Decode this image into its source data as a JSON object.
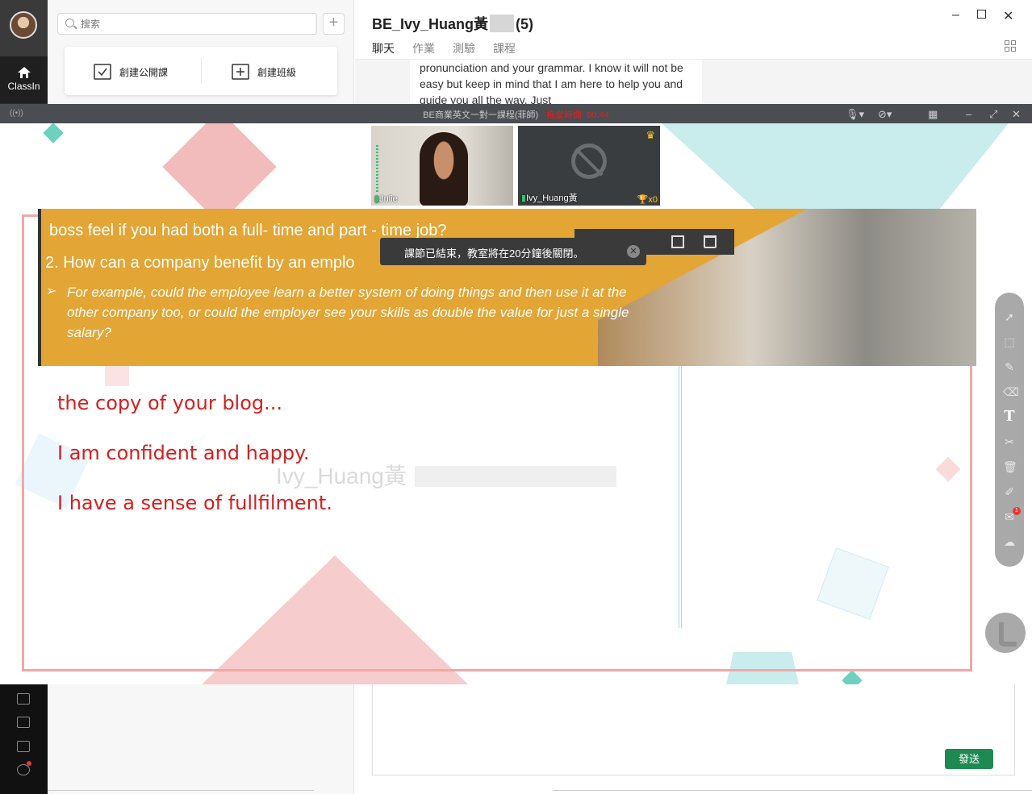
{
  "app": {
    "name": "ClassIn"
  },
  "search": {
    "placeholder": "搜索"
  },
  "create": {
    "open_course": "創建公開課",
    "class": "創建班級"
  },
  "chat": {
    "title": "BE_Ivy_Huang黃",
    "member_count": "(5)",
    "tabs": [
      "聊天",
      "作業",
      "測驗",
      "課程"
    ],
    "message_text": "pronunciation and your grammar. I know it will not be easy but keep in mind that I am here to help you and guide you all the way. Just",
    "send_label": "發送"
  },
  "classroom": {
    "title": "BE商業英文一對一課程(菲師)",
    "timer": "拖堂時間: 00:44",
    "toast": "課節已結束，教室將在20分鐘後關閉。",
    "videos": [
      {
        "name": "Julie"
      },
      {
        "name": "Ivy_Huang黃",
        "trophies": "x0"
      }
    ],
    "slide": {
      "line1": "boss feel if you had both a full- time and part - time job?",
      "line2": "2. How can a company benefit by an emplo",
      "line3": "For example, could the employee learn a better system of doing things and then use it at the other company too, or could the employer see your skills as double the value for just a single salary?"
    },
    "handwriting": [
      "the copy of your blog...",
      "I am confident and happy.",
      "I have a sense of fullfilment."
    ],
    "watermark": "Ivy_Huang黃",
    "toolbar_badge": "1"
  },
  "colors": {
    "accent": "#1aa160",
    "send": "#1c8a52",
    "ink": "#d81e1e",
    "slide": "#e3a533"
  }
}
